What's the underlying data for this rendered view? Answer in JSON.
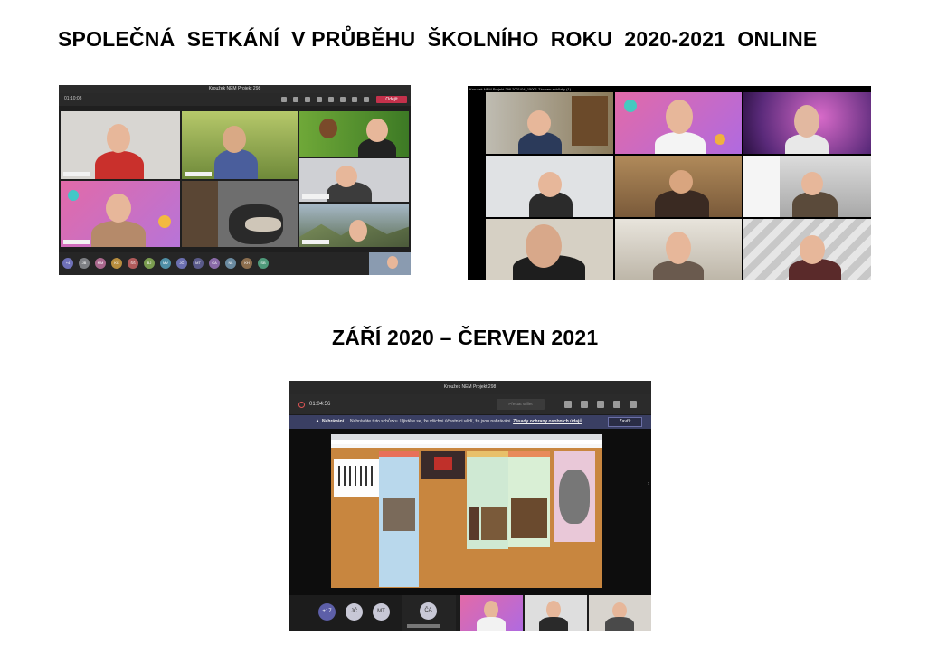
{
  "headings": {
    "top": "SPOLEČNÁ  SETKÁNÍ  V PRŮBĚHU  ŠKOLNÍHO  ROKU  2020-2021  ONLINE",
    "middle": "ZÁŘÍ 2020 – ČERVEN 2021"
  },
  "screenshot1": {
    "window_title": "Kroužek NEM Projekt 298",
    "timer": "01:10:08",
    "leave_label": "Odejít",
    "participants": [
      "+4",
      "JB",
      "MM",
      "KC",
      "ŠŠ",
      "BJ",
      "MV",
      "JČ",
      "MT",
      "ČA",
      "NL",
      "KH",
      "SB"
    ]
  },
  "screenshot2": {
    "caption": "Kroužek NEM Projekt 298 2021/04_15001 Záznam schůzky (1)"
  },
  "screenshot3": {
    "window_title": "Kroužek NEM Projekt 298",
    "timer": "01:04:56",
    "share_button": "Přestat sdílet",
    "notice": {
      "label": "Nahrávání",
      "message": "Nahráváte tuto schůzku. Ujistěte se, že všichni účastníci vědí, že jsou nahráváni.",
      "link": "Zásady ochrany osobních údajů",
      "close": "Zavřít"
    },
    "dock": {
      "overflow": "+17",
      "avatar1": "JČ",
      "avatar2": "MT",
      "avatar3": "ČA"
    }
  }
}
